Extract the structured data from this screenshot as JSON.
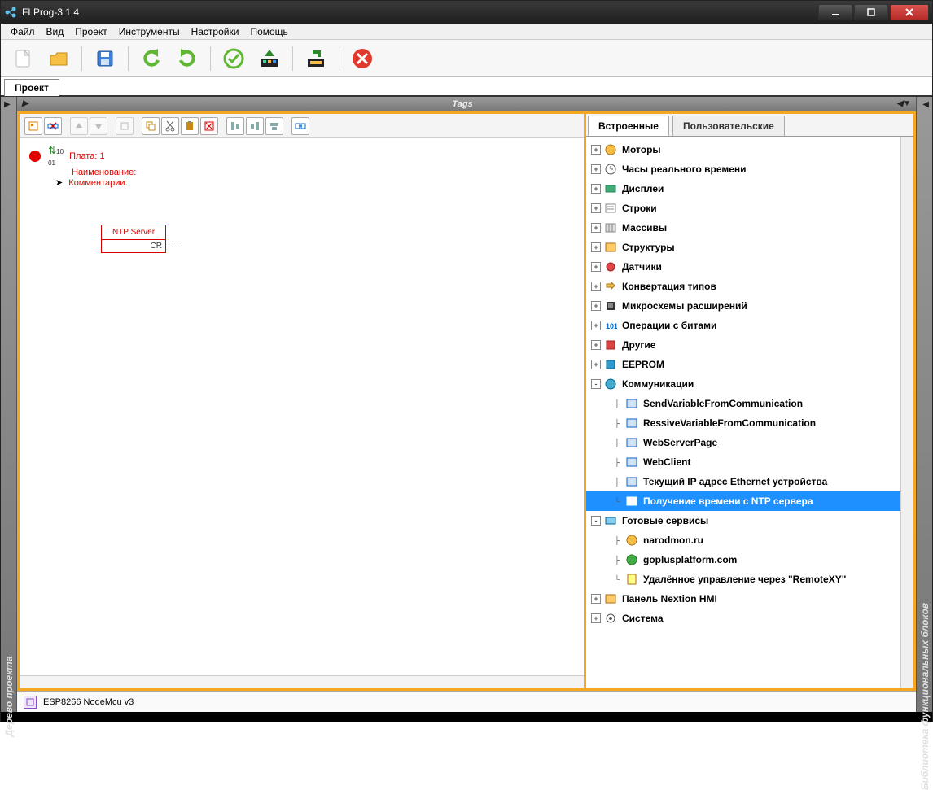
{
  "window": {
    "title": "FLProg-3.1.4"
  },
  "menu": {
    "file": "Файл",
    "view": "Вид",
    "project": "Проект",
    "tools": "Инструменты",
    "settings": "Настройки",
    "help": "Помощь"
  },
  "project_tab": "Проект",
  "sidebar_left": "Дерево проекта",
  "sidebar_right": "Библиотека функциональных блоков",
  "tags_label": "Tags",
  "board": {
    "line1": "Плата: 1",
    "line2": "Наименование:",
    "line3": "Комментарии:"
  },
  "block": {
    "title": "NTP Server",
    "port": "CR"
  },
  "right_panel": {
    "tabs": {
      "builtin": "Встроенные",
      "user": "Пользовательские"
    },
    "tree": [
      {
        "label": "Моторы",
        "exp": "+",
        "icon": "motor"
      },
      {
        "label": "Часы реального времени",
        "exp": "+",
        "icon": "clock"
      },
      {
        "label": "Дисплеи",
        "exp": "+",
        "icon": "display"
      },
      {
        "label": "Строки",
        "exp": "+",
        "icon": "strings"
      },
      {
        "label": "Массивы",
        "exp": "+",
        "icon": "array"
      },
      {
        "label": "Структуры",
        "exp": "+",
        "icon": "struct"
      },
      {
        "label": "Датчики",
        "exp": "+",
        "icon": "sensor"
      },
      {
        "label": "Конвертация типов",
        "exp": "+",
        "icon": "convert"
      },
      {
        "label": "Микросхемы расширений",
        "exp": "+",
        "icon": "chip"
      },
      {
        "label": "Операции с битами",
        "exp": "+",
        "icon": "bits"
      },
      {
        "label": "Другие",
        "exp": "+",
        "icon": "other"
      },
      {
        "label": "EEPROM",
        "exp": "+",
        "icon": "eeprom"
      },
      {
        "label": "Коммуникации",
        "exp": "-",
        "icon": "comm",
        "children": [
          {
            "label": "SendVariableFromCommunication",
            "icon": "item"
          },
          {
            "label": "RessiveVariableFromCommunication",
            "icon": "item"
          },
          {
            "label": "WebServerPage",
            "icon": "item"
          },
          {
            "label": "WebClient",
            "icon": "item"
          },
          {
            "label": "Текущий IP адрес Ethernet устройства",
            "icon": "item"
          },
          {
            "label": "Получение времени с NTP сервера",
            "icon": "item",
            "selected": true
          }
        ]
      },
      {
        "label": "Готовые сервисы",
        "exp": "-",
        "icon": "services",
        "children": [
          {
            "label": "narodmon.ru",
            "icon": "web"
          },
          {
            "label": "goplusplatform.com",
            "icon": "webg"
          },
          {
            "label": "Удалённое управление через \"RemoteXY\"",
            "icon": "remote"
          }
        ]
      },
      {
        "label": "Панель Nextion HMI",
        "exp": "+",
        "icon": "panel"
      },
      {
        "label": "Система",
        "exp": "+",
        "icon": "system"
      }
    ]
  },
  "status": {
    "board": "ESP8266 NodeMcu v3"
  }
}
